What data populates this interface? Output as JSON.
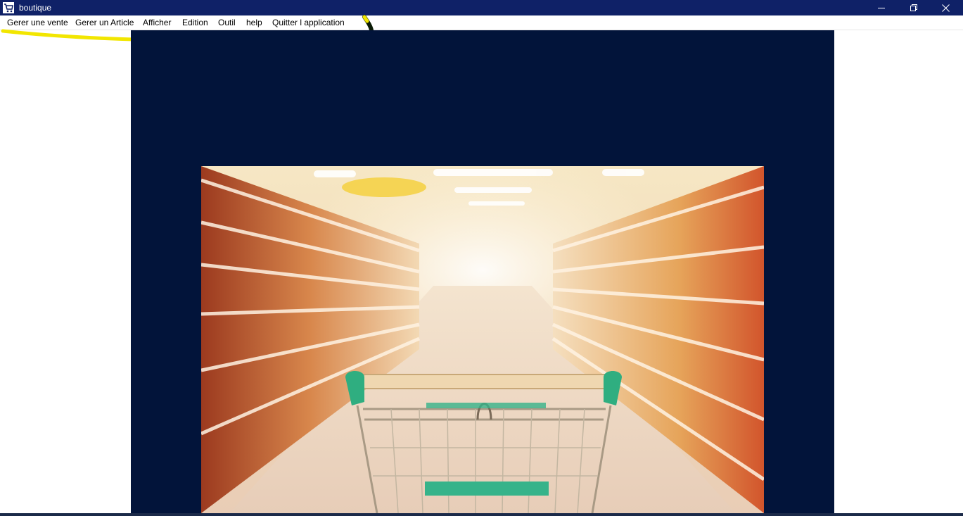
{
  "window": {
    "title": "boutique",
    "app_icon": "shopping-cart-icon"
  },
  "window_controls": [
    "minimize-icon",
    "restore-icon",
    "close-icon"
  ],
  "menu": {
    "items": [
      {
        "label": "Gerer une vente"
      },
      {
        "label": "Gerer un Article"
      },
      {
        "label": "Afficher"
      },
      {
        "label": "Edition"
      },
      {
        "label": "Outil"
      },
      {
        "label": "help"
      },
      {
        "label": "Quitter l application"
      }
    ]
  },
  "colors": {
    "titlebar": "#0f2167",
    "panel": "#02143a",
    "highlight_yellow": "#f2e600",
    "highlight_dark": "#0b1b05"
  },
  "main_image": {
    "subject": "blurred supermarket aisle with shopping cart in foreground"
  }
}
